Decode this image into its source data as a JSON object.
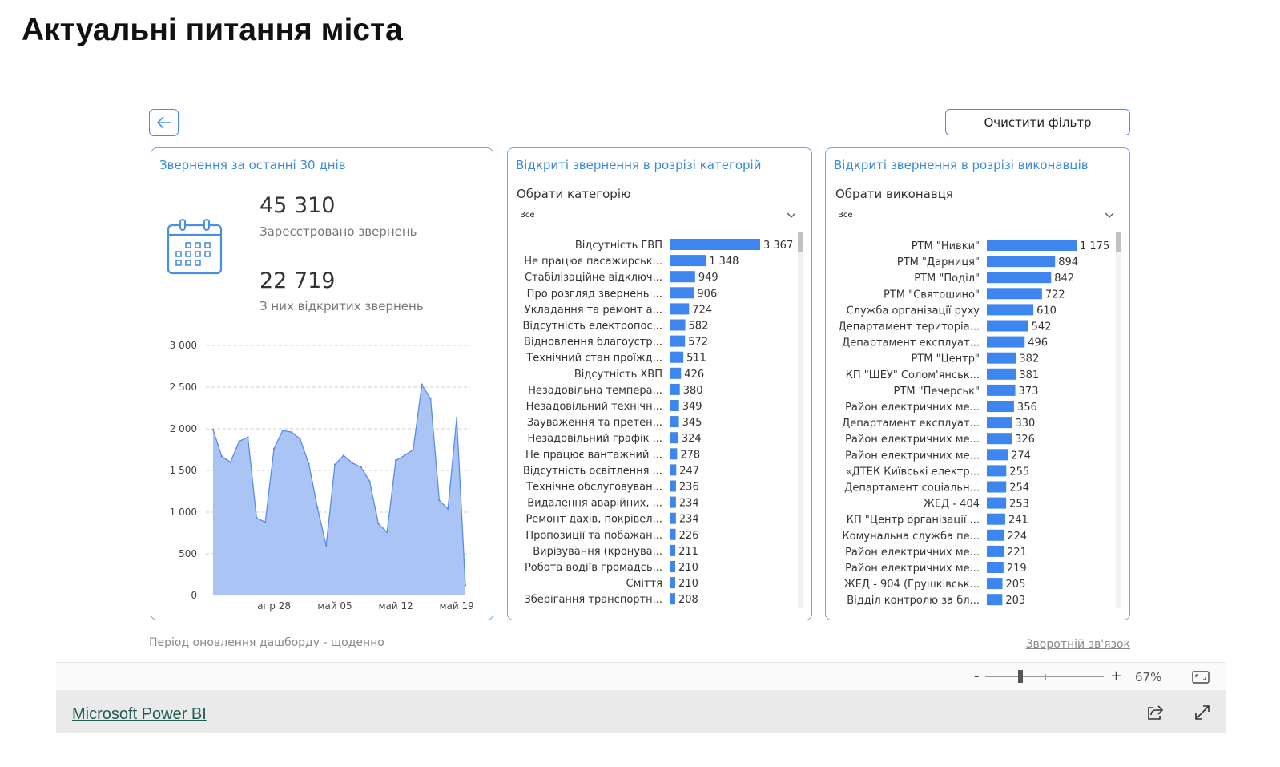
{
  "page": {
    "title": "Актуальні питання міста"
  },
  "toolbar": {
    "clear_filter_label": "Очистити фільтр"
  },
  "panel_left": {
    "title": "Звернення за останні 30 днів",
    "kpi_registered_value": "45 310",
    "kpi_registered_label": "Зареєстровано звернень",
    "kpi_open_value": "22 719",
    "kpi_open_label": "З них відкритих звернень",
    "icon": "calendar-icon"
  },
  "panel_categories": {
    "title": "Відкриті звернення в розрізі категорій",
    "slicer_title": "Обрати категорію",
    "slicer_value": "Все"
  },
  "panel_executors": {
    "title": "Відкриті звернення в розрізі виконавців",
    "slicer_title": "Обрати виконавця",
    "slicer_value": "Все"
  },
  "footer": {
    "note": "Період оновлення дашборду - щоденно",
    "feedback": "Зворотній зв'язок"
  },
  "zoom": {
    "minus": "-",
    "plus": "+",
    "percent": "67%",
    "level": 0.3
  },
  "bottom": {
    "link": "Microsoft Power BI"
  },
  "colors": {
    "accent": "#3a8ad8",
    "bar": "#3d86f0",
    "area_fill": "#a9c4f5",
    "area_line": "#5b8de8"
  },
  "chart_data": [
    {
      "type": "area",
      "x_tick_labels": [
        "апр 28",
        "май 05",
        "май 12",
        "май 19"
      ],
      "y_tick_labels": [
        "0",
        "500",
        "1 000",
        "1 500",
        "2 000",
        "2 500",
        "3 000"
      ],
      "ylim": [
        0,
        3000
      ],
      "grid": true,
      "x": [
        "апр 21",
        "апр 22",
        "апр 23",
        "апр 24",
        "апр 25",
        "апр 26",
        "апр 27",
        "апр 28",
        "апр 29",
        "апр 30",
        "май 01",
        "май 02",
        "май 03",
        "май 04",
        "май 05",
        "май 06",
        "май 07",
        "май 08",
        "май 09",
        "май 10",
        "май 11",
        "май 12",
        "май 13",
        "май 14",
        "май 15",
        "май 16",
        "май 17",
        "май 18",
        "май 19",
        "май 20"
      ],
      "values": [
        1990,
        1670,
        1600,
        1850,
        1900,
        930,
        880,
        1760,
        1980,
        1960,
        1880,
        1580,
        1050,
        600,
        1570,
        1680,
        1590,
        1540,
        1370,
        860,
        760,
        1620,
        1680,
        1750,
        2530,
        2360,
        1140,
        1040,
        2130,
        120
      ]
    },
    {
      "type": "bar",
      "categories": [
        "Відсутність ГВП",
        "Не працює пасажирськ...",
        "Стабілізаційне відключ...",
        "Про розгляд звернень ...",
        "Укладання та ремонт а...",
        "Відсутність електропос...",
        "Відновлення благоустр...",
        "Технічний стан проїжд...",
        "Відсутність ХВП",
        "Незадовільна темпера...",
        "Незадовільний технічн...",
        "Зауваження та претен...",
        "Незадовільний графік ...",
        "Не працює вантажний ...",
        "Відсутність освітлення ...",
        "Технічне обслуговуван...",
        "Видалення аварійних, ...",
        "Ремонт дахів, покрівел...",
        "Пропозиції та побажан...",
        "Вирізування (кронува...",
        "Робота водіїв громадсь...",
        "Сміття",
        "Зберігання транспортн..."
      ],
      "values": [
        3367,
        1348,
        949,
        906,
        724,
        582,
        572,
        511,
        426,
        380,
        349,
        345,
        324,
        278,
        247,
        236,
        234,
        234,
        226,
        211,
        210,
        210,
        208
      ],
      "value_labels": [
        "3 367",
        "1 348",
        "949",
        "906",
        "724",
        "582",
        "572",
        "511",
        "426",
        "380",
        "349",
        "345",
        "324",
        "278",
        "247",
        "236",
        "234",
        "234",
        "226",
        "211",
        "210",
        "210",
        "208"
      ]
    },
    {
      "type": "bar",
      "categories": [
        "РТМ \"Нивки\"",
        "РТМ \"Дарниця\"",
        "РТМ \"Поділ\"",
        "РТМ \"Святошино\"",
        "Служба організації руху",
        "Департамент територіа...",
        "Департамент експлуат...",
        "РТМ \"Центр\"",
        "КП \"ШЕУ\" Солом'янськ...",
        "РТМ \"Печерськ\"",
        "Район електричних ме...",
        "Департамент експлуат...",
        "Район електричних ме...",
        "Район електричних ме...",
        "«ДТЕК Київські електр...",
        "Департамент соціальн...",
        "ЖЕД - 404",
        "КП \"Центр організації ...",
        "Комунальна служба пе...",
        "Район електричних ме...",
        "Район електричних ме...",
        "ЖЕД - 904 (Грушківськ...",
        "Відділ контролю за бл..."
      ],
      "values": [
        1175,
        894,
        842,
        722,
        610,
        542,
        496,
        382,
        381,
        373,
        356,
        330,
        326,
        274,
        255,
        254,
        253,
        241,
        224,
        221,
        219,
        205,
        203
      ],
      "value_labels": [
        "1 175",
        "894",
        "842",
        "722",
        "610",
        "542",
        "496",
        "382",
        "381",
        "373",
        "356",
        "330",
        "326",
        "274",
        "255",
        "254",
        "253",
        "241",
        "224",
        "221",
        "219",
        "205",
        "203"
      ]
    }
  ]
}
